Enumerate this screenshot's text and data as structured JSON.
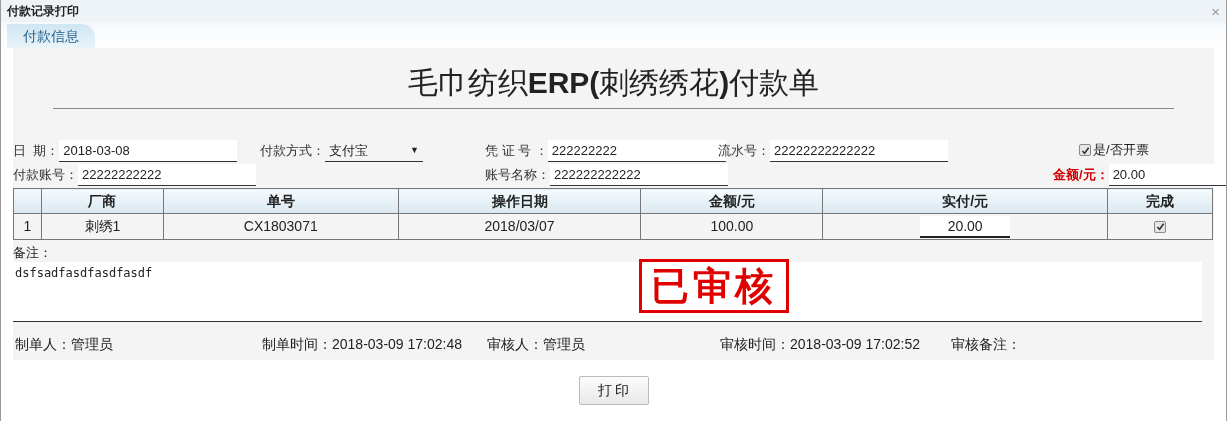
{
  "window": {
    "title": "付款记录打印",
    "close": "×"
  },
  "tabs": [
    {
      "label": "付款信息",
      "selected": true
    }
  ],
  "form": {
    "title": "毛巾纺织**ERP(**刺绣绣花**)**付款单",
    "fields": [
      {
        "kind": "text",
        "label": "日  期：",
        "value": "2018-03-08"
      },
      {
        "kind": "select",
        "label": "付款方式：",
        "value": "支付宝",
        "caret": "▼"
      },
      {
        "kind": "text",
        "label": "凭 证 号 ：",
        "value": "222222222"
      },
      {
        "kind": "text",
        "label": "流水号：",
        "value": "22222222222222"
      },
      {
        "kind": "checkbox",
        "label": "是/否开票",
        "checked": true
      },
      {
        "kind": "text",
        "label": "付款账号：",
        "value": "22222222222"
      },
      {
        "kind": "text",
        "label": "账号名称：",
        "value": "222222222222"
      },
      {
        "kind": "text",
        "label": "金额/元：",
        "value": "20.00",
        "emphasis": true
      }
    ]
  },
  "table": {
    "columns": [
      "",
      "厂商",
      "单号",
      "操作日期",
      "金额/元",
      "实付/元",
      "完成"
    ],
    "rows": [
      [
        {
          "kind": "text",
          "text": "1"
        },
        {
          "kind": "text",
          "text": "刺绣1"
        },
        {
          "kind": "text",
          "text": "CX1803071"
        },
        {
          "kind": "text",
          "text": "2018/03/07"
        },
        {
          "kind": "text",
          "text": "100.00"
        },
        {
          "kind": "input",
          "text": "20.00"
        },
        {
          "kind": "checkbox",
          "checked": true
        }
      ]
    ]
  },
  "remarks": {
    "label": "备注：",
    "value": "dsfsadfasdfasdfasdf"
  },
  "stamp": {
    "text": "已审核"
  },
  "footer": [
    {
      "label": "制单人：",
      "value": "管理员"
    },
    {
      "label": "制单时间：",
      "value": "2018-03-09 17:02:48"
    },
    {
      "label": "审核人：",
      "value": "管理员"
    },
    {
      "label": "审核时间：",
      "value": "2018-03-09 17:02:52"
    },
    {
      "label": "审核备注："
    }
  ],
  "buttons": [
    "打 印"
  ]
}
